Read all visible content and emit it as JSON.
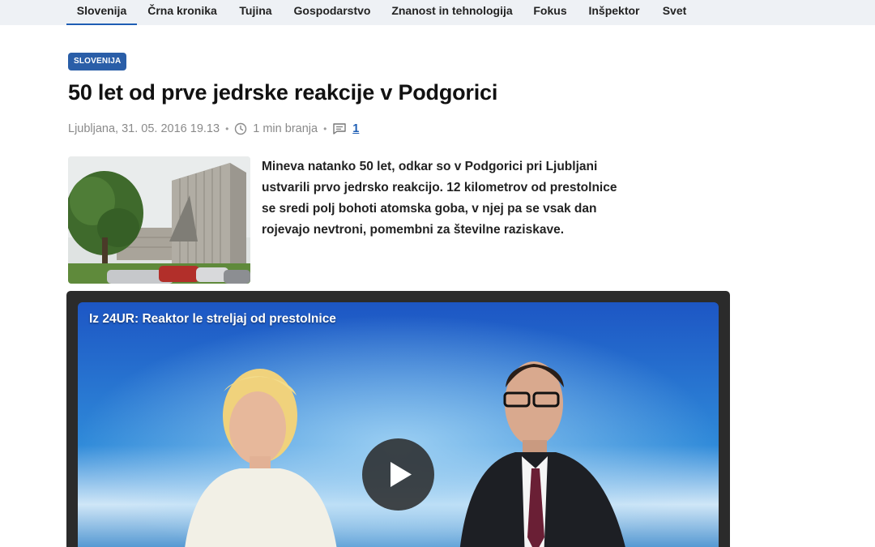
{
  "nav": {
    "items": [
      {
        "label": "Slovenija",
        "active": true
      },
      {
        "label": "Črna kronika"
      },
      {
        "label": "Tujina"
      },
      {
        "label": "Gospodarstvo"
      },
      {
        "label": "Znanost in tehnologija"
      },
      {
        "label": "Fokus"
      },
      {
        "label": "Inšpektor"
      },
      {
        "label": "Svet"
      }
    ]
  },
  "article": {
    "category": "SLOVENIJA",
    "title": "50 let od prve jedrske reakcije v Podgorici",
    "meta": {
      "location_date": "Ljubljana, 31. 05. 2016 19.13",
      "read_time": "1 min branja",
      "comments": "1"
    },
    "lead": "Mineva natanko 50 let, odkar so v Podgorici pri Ljubljani ustvarili prvo jedrsko reakcijo. 12 kilometrov od prestolnice se sredi polj bohoti atomska goba, v njej pa se vsak dan rojevajo nevtroni, pomembni za številne raziskave."
  },
  "video": {
    "title": "Iz 24UR: Reaktor le streljaj od prestolnice"
  },
  "icons": {
    "clock": "clock-icon",
    "comments": "comment-icon",
    "play": "play-icon"
  },
  "colors": {
    "accent": "#2a5ea8",
    "nav_bg": "#eef1f5",
    "link": "#1e5eb4"
  }
}
